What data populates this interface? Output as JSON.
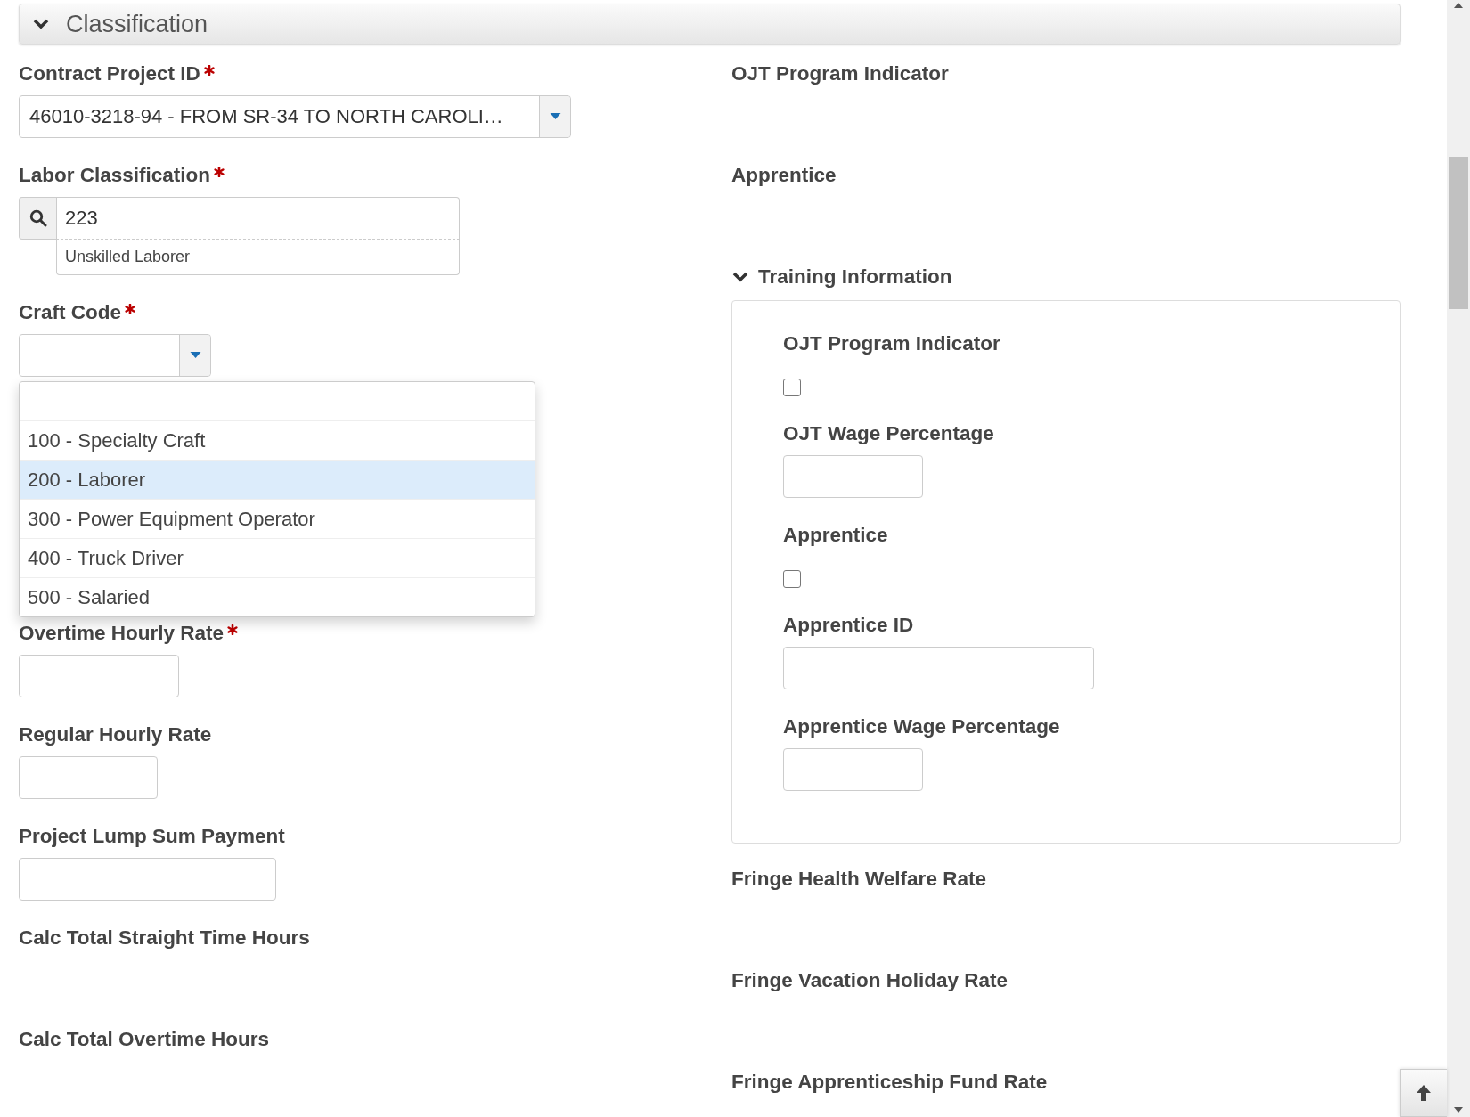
{
  "section": {
    "title": "Classification",
    "expanded": true
  },
  "left_fields": [
    {
      "kind": "select",
      "label": "Contract Project ID",
      "required": true,
      "value": "46010-3218-94 - FROM SR-34 TO NORTH CAROLI…"
    },
    {
      "kind": "lookup",
      "label": "Labor Classification",
      "required": true,
      "value": "223",
      "description": "Unskilled Laborer"
    },
    {
      "kind": "select",
      "label": "Craft Code",
      "required": true,
      "open": true,
      "options": [
        {
          "label": "100 - Specialty Craft",
          "selected": false
        },
        {
          "label": "200 - Laborer",
          "selected": true
        },
        {
          "label": "300 - Power Equipment Operator",
          "selected": false
        },
        {
          "label": "400 - Truck Driver",
          "selected": false
        },
        {
          "label": "500 - Salaried",
          "selected": false
        }
      ]
    },
    {
      "kind": "input",
      "label": "Overtime Hourly Rate",
      "required": true
    },
    {
      "kind": "input",
      "label": "Regular Hourly Rate",
      "required": false
    },
    {
      "kind": "input",
      "label": "Project Lump Sum Payment",
      "required": false
    },
    {
      "kind": "readonly",
      "label": "Calc Total Straight Time Hours"
    },
    {
      "kind": "readonly",
      "label": "Calc Total Overtime Hours"
    }
  ],
  "right_fields": [
    {
      "kind": "readonly",
      "label": "OJT Program Indicator"
    },
    {
      "kind": "readonly",
      "label": "Apprentice"
    },
    {
      "kind": "group",
      "title": "Training Information",
      "expanded": true,
      "fields": [
        {
          "kind": "checkbox",
          "label": "OJT Program Indicator",
          "checked": false
        },
        {
          "kind": "input",
          "label": "OJT Wage Percentage"
        },
        {
          "kind": "checkbox",
          "label": "Apprentice",
          "checked": false
        },
        {
          "kind": "input",
          "label": "Apprentice ID"
        },
        {
          "kind": "input",
          "label": "Apprentice Wage Percentage"
        }
      ]
    },
    {
      "kind": "readonly",
      "label": "Fringe Health Welfare Rate"
    },
    {
      "kind": "readonly",
      "label": "Fringe Vacation Holiday Rate"
    },
    {
      "kind": "readonly",
      "label": "Fringe Apprenticeship Fund Rate"
    }
  ]
}
